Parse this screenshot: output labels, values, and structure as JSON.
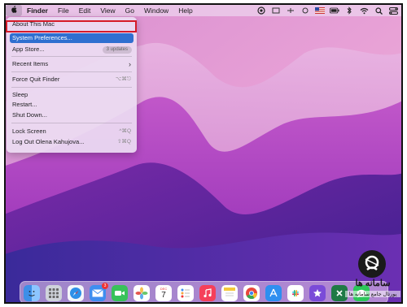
{
  "menubar": {
    "items": [
      "Finder",
      "File",
      "Edit",
      "View",
      "Go",
      "Window",
      "Help"
    ]
  },
  "apple_menu": {
    "items": [
      {
        "label": "About This Mac",
        "shortcut": ""
      },
      {
        "label": "System Preferences...",
        "shortcut": "",
        "selected": true
      },
      {
        "label": "App Store...",
        "badge": "3 updates"
      },
      {
        "label": "Recent Items",
        "shortcut": "›"
      },
      {
        "label": "Force Quit Finder",
        "shortcut": "⌥⌘⎋"
      },
      {
        "label": "Sleep",
        "shortcut": ""
      },
      {
        "label": "Restart...",
        "shortcut": ""
      },
      {
        "label": "Shut Down...",
        "shortcut": ""
      },
      {
        "label": "Lock Screen",
        "shortcut": "^⌘Q"
      },
      {
        "label": "Log Out Olena Kahujova...",
        "shortcut": "⇧⌘Q"
      }
    ]
  },
  "dock": {
    "calendar_month": "DEC",
    "calendar_day": "7",
    "mail_badge": "3"
  },
  "watermark": {
    "title": "سامانه ها",
    "subtitle": "پورتال جامع سامانه ها"
  },
  "colors": {
    "highlight_border": "#d51a28",
    "selection": "#2f6fd0"
  }
}
